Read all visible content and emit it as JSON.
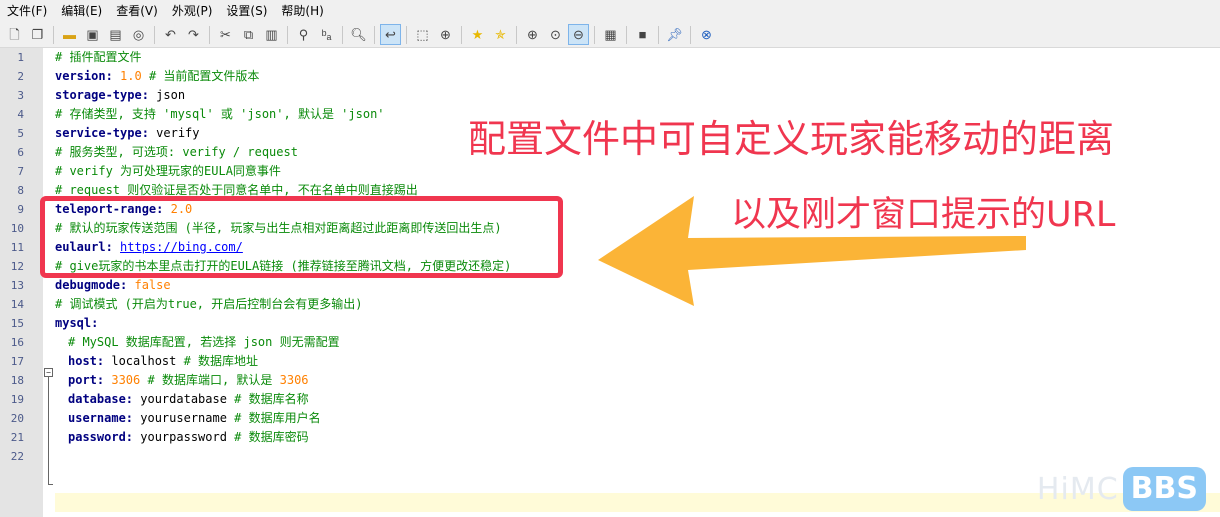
{
  "menu": [
    "文件(F)",
    "编辑(E)",
    "查看(V)",
    "外观(P)",
    "设置(S)",
    "帮助(H)"
  ],
  "toolbar": {
    "icons": [
      "new-file-icon",
      "open-window-icon",
      "open-folder-icon",
      "save-icon",
      "save-all-icon",
      "reload-icon",
      "undo-icon",
      "redo-icon",
      "cut-icon",
      "copy-icon",
      "paste-icon",
      "find-icon",
      "replace-icon",
      "find-next-icon",
      "word-wrap-icon",
      "select-icon",
      "zoom-find-icon",
      "favorite-icon",
      "add-favorite-icon",
      "zoom-in-icon",
      "zoom-reset-icon",
      "zoom-out-icon",
      "encoding-icon",
      "console-icon",
      "pin-icon",
      "close-circle-icon"
    ]
  },
  "lines": [
    {
      "n": "1",
      "parts": [
        {
          "t": "# 插件配置文件",
          "c": "cmt"
        }
      ]
    },
    {
      "n": "2",
      "parts": [
        {
          "t": "version:",
          "c": "key"
        },
        {
          "t": " ",
          "c": "val"
        },
        {
          "t": "1.0",
          "c": "num"
        },
        {
          "t": " # 当前配置文件版本",
          "c": "cmt"
        }
      ]
    },
    {
      "n": "3",
      "parts": [
        {
          "t": "storage-type:",
          "c": "key"
        },
        {
          "t": " json",
          "c": "val"
        }
      ]
    },
    {
      "n": "4",
      "parts": [
        {
          "t": "# 存储类型, 支持 'mysql' 或 'json', 默认是 'json'",
          "c": "cmt"
        }
      ]
    },
    {
      "n": "5",
      "parts": [
        {
          "t": "service-type:",
          "c": "key"
        },
        {
          "t": " verify",
          "c": "val"
        }
      ]
    },
    {
      "n": "6",
      "parts": [
        {
          "t": "# 服务类型, 可选项: verify / request",
          "c": "cmt"
        }
      ]
    },
    {
      "n": "7",
      "parts": [
        {
          "t": "# verify 为可处理玩家的EULA同意事件",
          "c": "cmt"
        }
      ]
    },
    {
      "n": "8",
      "parts": [
        {
          "t": "# request 则仅验证是否处于同意名单中, 不在名单中则直接踢出",
          "c": "cmt"
        }
      ]
    },
    {
      "n": "9",
      "parts": [
        {
          "t": "teleport-range:",
          "c": "key"
        },
        {
          "t": " ",
          "c": "val"
        },
        {
          "t": "2.0",
          "c": "num"
        }
      ]
    },
    {
      "n": "10",
      "parts": [
        {
          "t": "# 默认的玩家传送范围 (半径, 玩家与出生点相对距离超过此距离即传送回出生点)",
          "c": "cmt"
        }
      ]
    },
    {
      "n": "11",
      "parts": [
        {
          "t": "eulaurl:",
          "c": "key"
        },
        {
          "t": " ",
          "c": "val"
        },
        {
          "t": "https://bing.com/",
          "c": "url"
        }
      ]
    },
    {
      "n": "12",
      "parts": [
        {
          "t": "# give玩家的书本里点击打开的EULA链接 (推荐链接至腾讯文档, 方便更改还稳定)",
          "c": "cmt"
        }
      ]
    },
    {
      "n": "13",
      "parts": [
        {
          "t": "debugmode:",
          "c": "key"
        },
        {
          "t": " ",
          "c": "val"
        },
        {
          "t": "false",
          "c": "num"
        }
      ]
    },
    {
      "n": "14",
      "parts": [
        {
          "t": "# 调试模式 (开启为true, 开启后控制台会有更多输出)",
          "c": "cmt"
        }
      ]
    },
    {
      "n": "15",
      "parts": [
        {
          "t": "mysql:",
          "c": "key"
        }
      ]
    },
    {
      "n": "16",
      "indent": true,
      "parts": [
        {
          "t": "# MySQL 数据库配置, 若选择 json 则无需配置",
          "c": "cmt"
        }
      ]
    },
    {
      "n": "17",
      "indent": true,
      "parts": [
        {
          "t": "host:",
          "c": "key"
        },
        {
          "t": " localhost",
          "c": "val"
        },
        {
          "t": " # 数据库地址",
          "c": "cmt"
        }
      ]
    },
    {
      "n": "18",
      "indent": true,
      "parts": [
        {
          "t": "port:",
          "c": "key"
        },
        {
          "t": " ",
          "c": "val"
        },
        {
          "t": "3306",
          "c": "num"
        },
        {
          "t": " # 数据库端口, 默认是 ",
          "c": "cmt"
        },
        {
          "t": "3306",
          "c": "num"
        }
      ]
    },
    {
      "n": "19",
      "indent": true,
      "parts": [
        {
          "t": "database:",
          "c": "key"
        },
        {
          "t": " yourdatabase",
          "c": "val"
        },
        {
          "t": " # 数据库名称",
          "c": "cmt"
        }
      ]
    },
    {
      "n": "20",
      "indent": true,
      "parts": [
        {
          "t": "username:",
          "c": "key"
        },
        {
          "t": " yourusername",
          "c": "val"
        },
        {
          "t": " # 数据库用户名",
          "c": "cmt"
        }
      ]
    },
    {
      "n": "21",
      "indent": true,
      "parts": [
        {
          "t": "password:",
          "c": "key"
        },
        {
          "t": " yourpassword",
          "c": "val"
        },
        {
          "t": " # 数据库密码",
          "c": "cmt"
        }
      ]
    },
    {
      "n": "22",
      "parts": []
    }
  ],
  "annotation": {
    "line1": "配置文件中可自定义玩家能移动的距离",
    "line2": "以及刚才窗口提示的URL",
    "color": "#f0364f",
    "arrow_color": "#fbb437"
  },
  "watermark": {
    "text": "HiMC",
    "badge": "BBS"
  }
}
